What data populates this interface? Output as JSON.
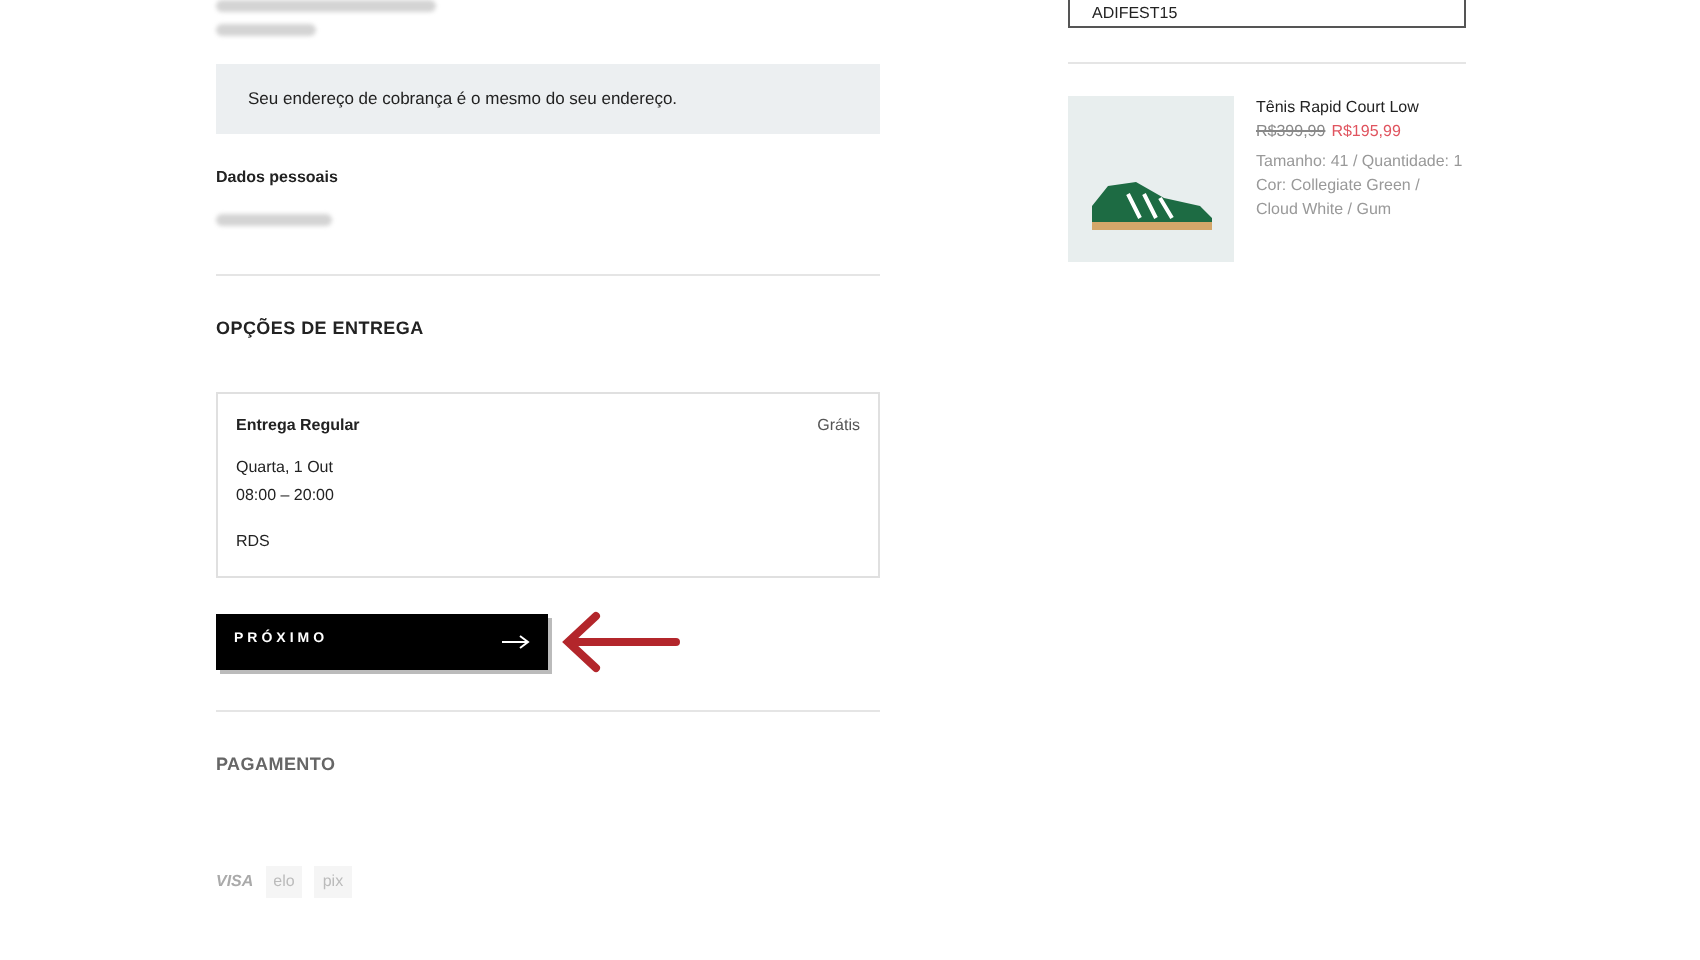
{
  "billing_notice": "Seu endereço de cobrança é o mesmo do seu endereço.",
  "personal": {
    "title": "Dados pessoais"
  },
  "delivery": {
    "title": "OPÇÕES DE ENTREGA",
    "option": {
      "name": "Entrega Regular",
      "price": "Grátis",
      "date": "Quarta, 1 Out",
      "hours": "08:00 – 20:00",
      "carrier": "RDS"
    }
  },
  "next_button": {
    "label": "PRÓXIMO"
  },
  "payment": {
    "title": "PAGAMENTO",
    "logos": [
      "VISA",
      "elo",
      "pix"
    ]
  },
  "coupon": {
    "code": "ADIFEST15"
  },
  "product": {
    "name": "Tênis Rapid Court Low",
    "old_price": "R$399,99",
    "price": "R$195,99",
    "size_qty": "Tamanho: 41 / Quantidade: 1",
    "color_text": "Cor: Collegiate Green / Cloud White / Gum"
  }
}
